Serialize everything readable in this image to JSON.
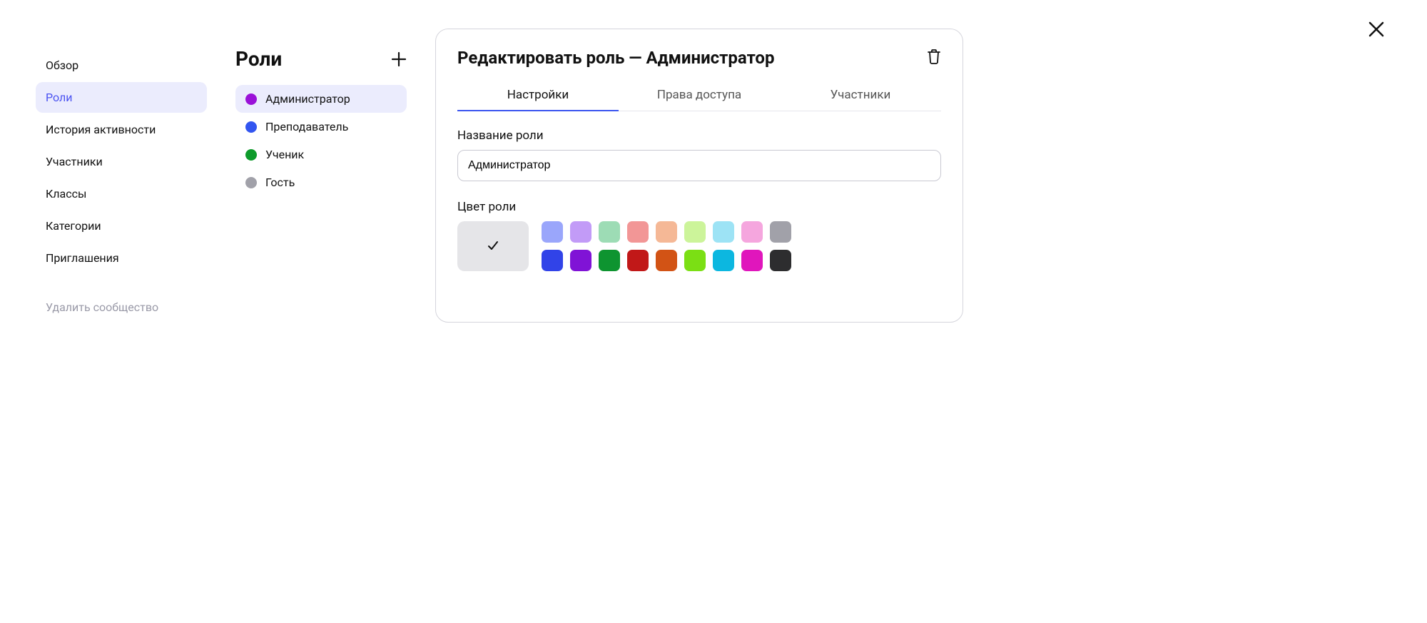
{
  "sidebar": {
    "items": [
      {
        "label": "Обзор",
        "active": false
      },
      {
        "label": "Роли",
        "active": true
      },
      {
        "label": "История активности",
        "active": false
      },
      {
        "label": "Участники",
        "active": false
      },
      {
        "label": "Классы",
        "active": false
      },
      {
        "label": "Категории",
        "active": false
      },
      {
        "label": "Приглашения",
        "active": false
      }
    ],
    "delete_label": "Удалить сообщество"
  },
  "roles": {
    "title": "Роли",
    "items": [
      {
        "label": "Администратор",
        "color": "#9a11d8",
        "active": true
      },
      {
        "label": "Преподаватель",
        "color": "#3255f0",
        "active": false
      },
      {
        "label": "Ученик",
        "color": "#0e9b2b",
        "active": false
      },
      {
        "label": "Гость",
        "color": "#a1a1a9",
        "active": false
      }
    ]
  },
  "panel": {
    "title": "Редактировать роль — Администратор",
    "tabs": [
      {
        "label": "Настройки",
        "active": true
      },
      {
        "label": "Права доступа",
        "active": false
      },
      {
        "label": "Участники",
        "active": false
      }
    ],
    "name_label": "Название роли",
    "name_value": "Администратор",
    "color_label": "Цвет роли",
    "default_color_selected": true,
    "colors_row1": [
      "#9aa6fb",
      "#c29bf7",
      "#9ddcb5",
      "#f29696",
      "#f5b896",
      "#ccf49a",
      "#9de3f5",
      "#f5a6de",
      "#a1a1a9"
    ],
    "colors_row2": [
      "#3143e8",
      "#8013d6",
      "#0e9430",
      "#c11818",
      "#d25315",
      "#7bdf14",
      "#0cb7e0",
      "#e016bc",
      "#2d2d2f"
    ]
  }
}
